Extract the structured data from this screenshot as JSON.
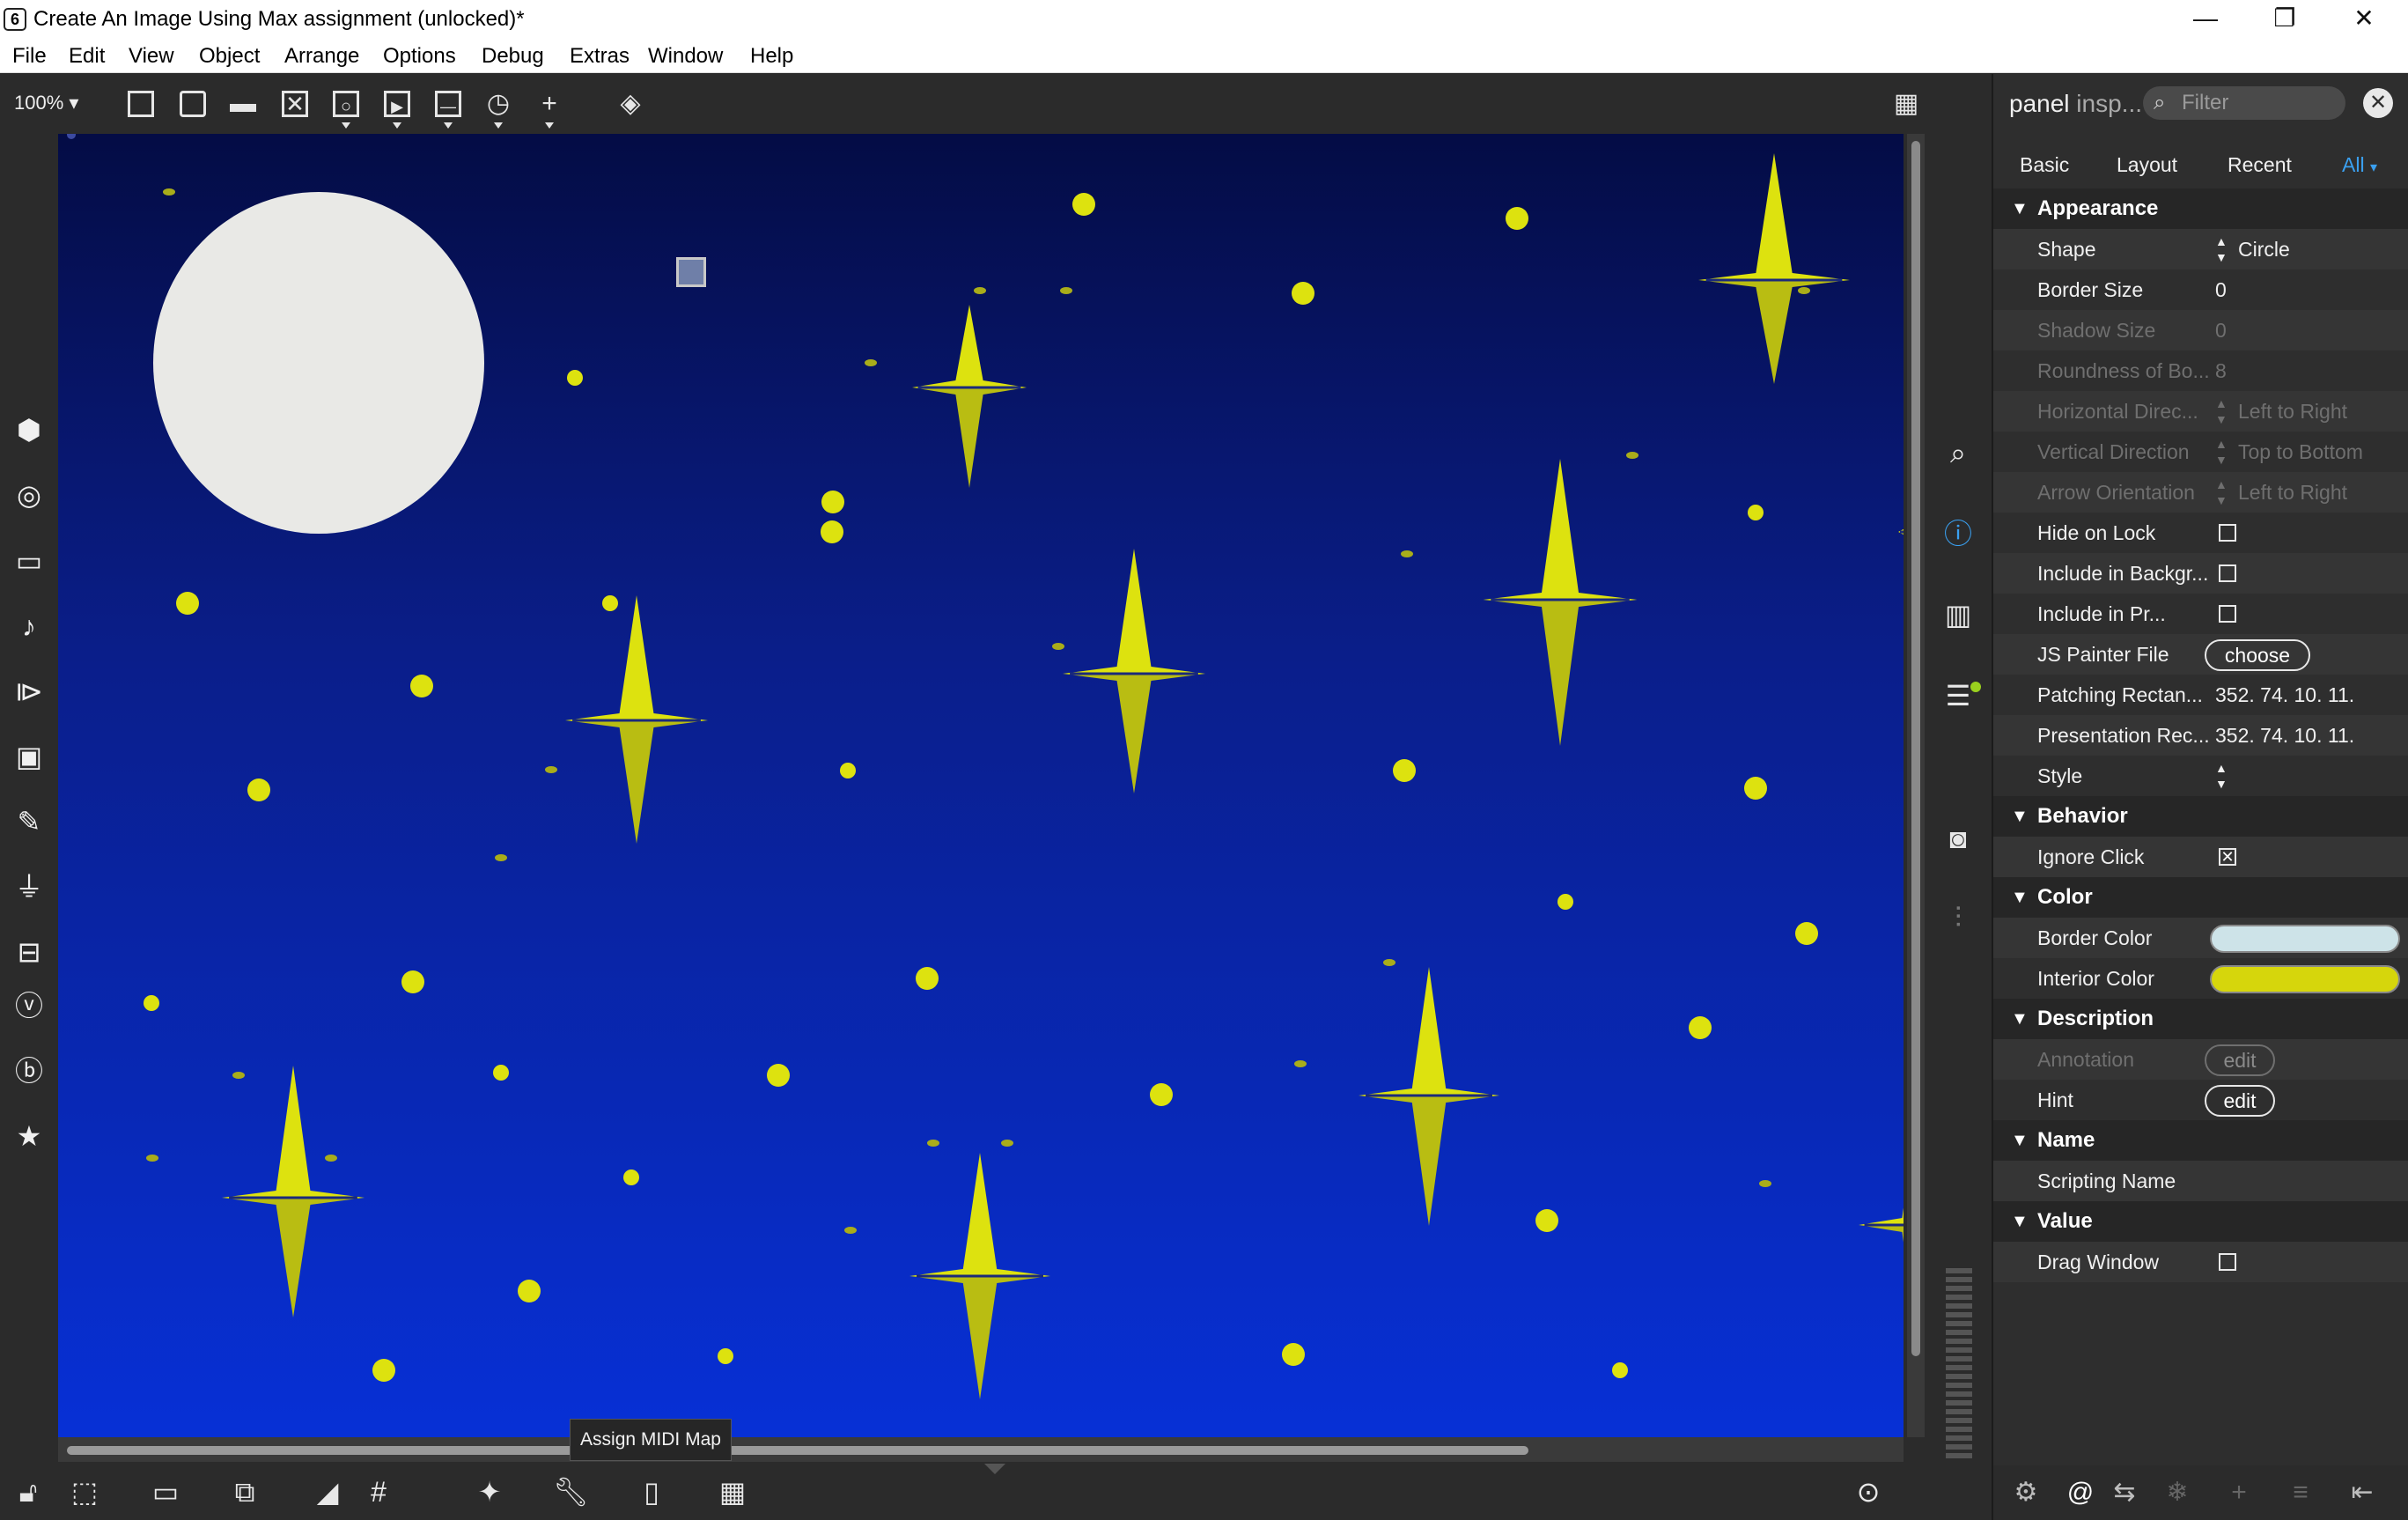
{
  "window": {
    "title": "Create An Image Using Max assignment (unlocked)*",
    "minimize": "—",
    "maximize": "❐",
    "close": "✕"
  },
  "menu": [
    "File",
    "Edit",
    "View",
    "Object",
    "Arrange",
    "Options",
    "Debug",
    "Extras",
    "Window",
    "Help"
  ],
  "toolbar": {
    "zoom": "100%"
  },
  "tooltip": "Assign MIDI Map",
  "inspector": {
    "title": "panel",
    "title_sub": "insp...",
    "filter_placeholder": "Filter",
    "tabs": [
      "Basic",
      "Layout",
      "Recent",
      "All"
    ],
    "active_tab": "All",
    "sections": {
      "appearance": "Appearance",
      "behavior": "Behavior",
      "color": "Color",
      "description": "Description",
      "name": "Name",
      "value": "Value"
    },
    "props": {
      "shape_label": "Shape",
      "shape_value": "Circle",
      "border_size_label": "Border Size",
      "border_size_value": "0",
      "shadow_size_label": "Shadow Size",
      "shadow_size_value": "0",
      "roundness_label": "Roundness of Bo...",
      "roundness_value": "8",
      "hdir_label": "Horizontal Direc...",
      "hdir_value": "Left to Right",
      "vdir_label": "Vertical Direction",
      "vdir_value": "Top to Bottom",
      "arrow_label": "Arrow Orientation",
      "arrow_value": "Left to Right",
      "hide_on_lock_label": "Hide on Lock",
      "include_bg_label": "Include in Backgr...",
      "include_pr_label": "Include in Pr...",
      "js_painter_label": "JS Painter File",
      "js_painter_button": "choose",
      "patching_rect_label": "Patching Rectan...",
      "patching_rect_value": "352. 74. 10. 11.",
      "presentation_rect_label": "Presentation Rec...",
      "presentation_rect_value": "352. 74. 10. 11.",
      "style_label": "Style",
      "ignore_click_label": "Ignore Click",
      "border_color_label": "Border Color",
      "interior_color_label": "Interior Color",
      "annotation_label": "Annotation",
      "annotation_button": "edit",
      "hint_label": "Hint",
      "hint_button": "edit",
      "scripting_name_label": "Scripting Name",
      "drag_window_label": "Drag Window"
    }
  },
  "colors": {
    "border_color": "#cde3e8",
    "interior_color": "#d6d60c",
    "star_yellow": "#dde20f",
    "moon": "#e9e9e6",
    "accent_blue": "#3aa0f0"
  }
}
